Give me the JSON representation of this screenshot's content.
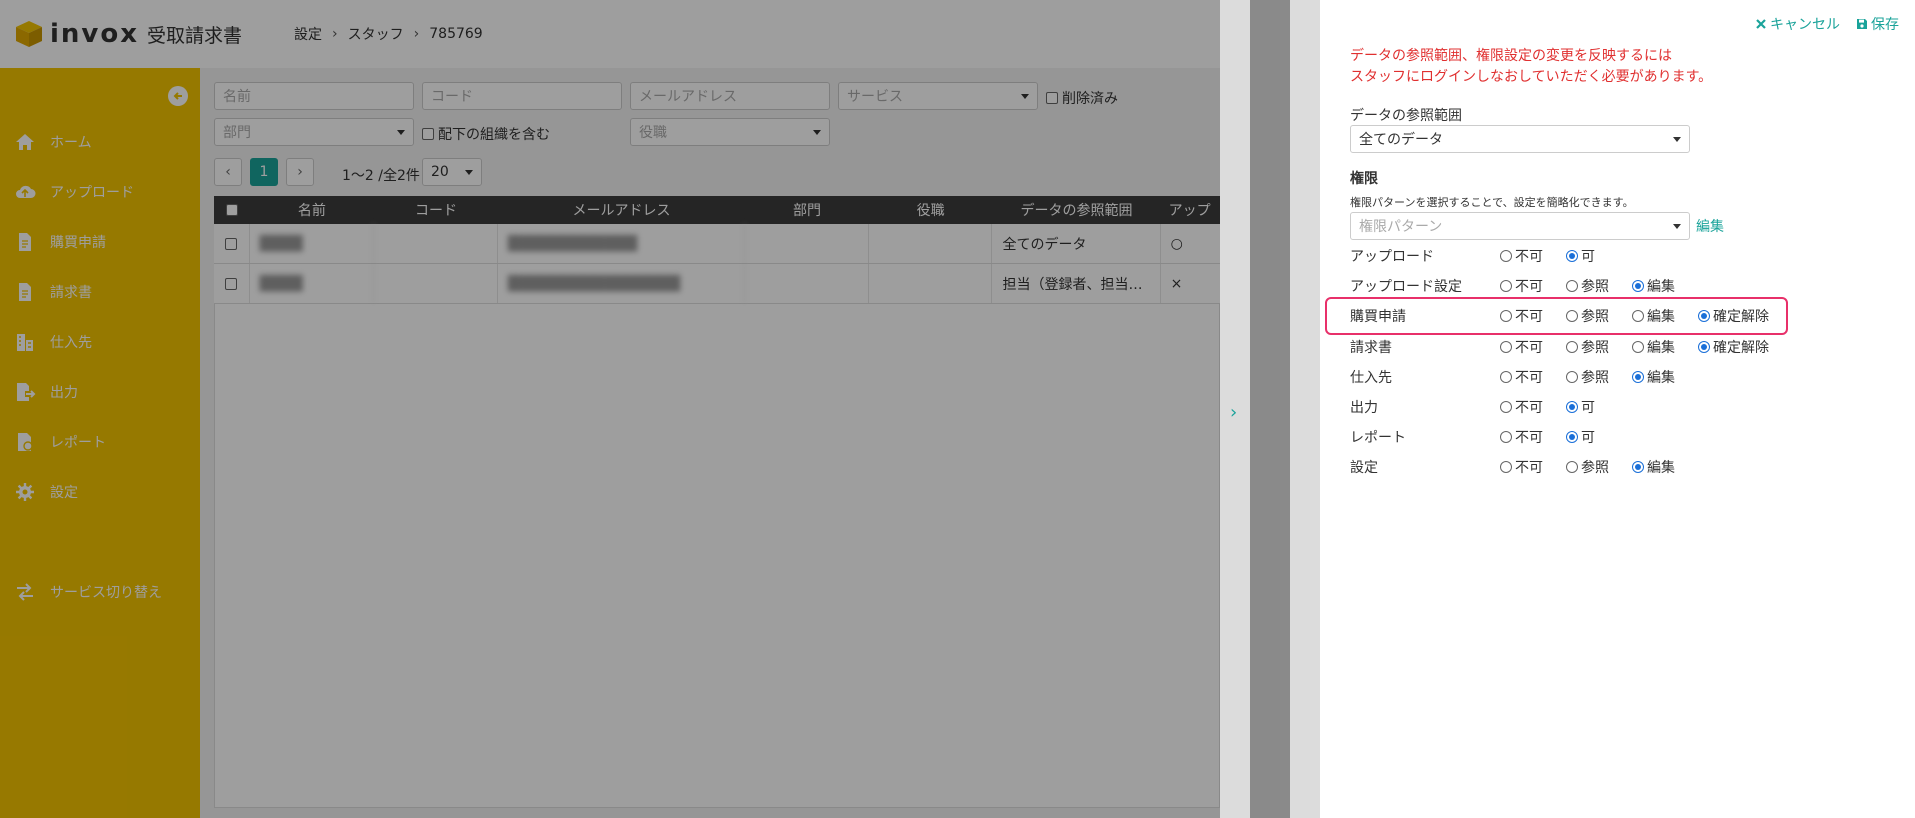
{
  "header": {
    "brand": "invox",
    "product": "受取請求書",
    "breadcrumb": [
      "設定",
      "スタッフ",
      "785769"
    ]
  },
  "sidebar": {
    "items": [
      {
        "label": "ホーム",
        "icon": "home-icon"
      },
      {
        "label": "アップロード",
        "icon": "cloud-upload-icon"
      },
      {
        "label": "購買申請",
        "icon": "document-icon"
      },
      {
        "label": "請求書",
        "icon": "document-icon"
      },
      {
        "label": "仕入先",
        "icon": "building-icon"
      },
      {
        "label": "出力",
        "icon": "export-icon"
      },
      {
        "label": "レポート",
        "icon": "report-icon"
      },
      {
        "label": "設定",
        "icon": "gear-icon"
      }
    ],
    "service_switch": {
      "label": "サービス切り替え",
      "icon": "switch-icon"
    }
  },
  "filters": {
    "name_placeholder": "名前",
    "code_placeholder": "コード",
    "email_placeholder": "メールアドレス",
    "service_placeholder": "サービス",
    "deleted_label": "削除済み",
    "department_placeholder": "部門",
    "include_sub_label": "配下の組織を含む",
    "role_placeholder": "役職"
  },
  "pager": {
    "current_page": "1",
    "summary": "1〜2 /全2件",
    "per_page": "20"
  },
  "table": {
    "columns": [
      "名前",
      "コード",
      "メールアドレス",
      "部門",
      "役職",
      "データの参照範囲",
      "アップ"
    ],
    "rows": [
      {
        "name": "████",
        "code": "",
        "email": "████████████",
        "department": "",
        "role": "",
        "scope": "全てのデータ",
        "upload": "○"
      },
      {
        "name": "████",
        "code": "",
        "email": "████████████████",
        "department": "",
        "role": "",
        "scope": "担当（登録者、担当…",
        "upload": "×"
      }
    ]
  },
  "panel": {
    "cancel_label": "キャンセル",
    "save_label": "保存",
    "notice_line1": "データの参照範囲、権限設定の変更を反映するには",
    "notice_line2": "スタッフにログインしなおしていただく必要があります。",
    "scope_label": "データの参照範囲",
    "scope_value": "全てのデータ",
    "perm_heading": "権限",
    "perm_hint": "権限パターンを選択することで、設定を簡略化できます。",
    "pattern_placeholder": "権限パターン",
    "pattern_edit": "編集",
    "permissions": [
      {
        "name": "アップロード",
        "options": [
          "不可",
          "可"
        ],
        "selected": "可"
      },
      {
        "name": "アップロード設定",
        "options": [
          "不可",
          "参照",
          "編集"
        ],
        "selected": "編集"
      },
      {
        "name": "購買申請",
        "options": [
          "不可",
          "参照",
          "編集",
          "確定解除"
        ],
        "selected": "確定解除"
      },
      {
        "name": "請求書",
        "options": [
          "不可",
          "参照",
          "編集",
          "確定解除"
        ],
        "selected": "確定解除"
      },
      {
        "name": "仕入先",
        "options": [
          "不可",
          "参照",
          "編集"
        ],
        "selected": "編集"
      },
      {
        "name": "出力",
        "options": [
          "不可",
          "可"
        ],
        "selected": "可"
      },
      {
        "name": "レポート",
        "options": [
          "不可",
          "可"
        ],
        "selected": "可"
      },
      {
        "name": "設定",
        "options": [
          "不可",
          "参照",
          "編集"
        ],
        "selected": "編集"
      }
    ]
  },
  "colors": {
    "sidebar": "#f3c400",
    "accent": "#1aa39a",
    "notice": "#e03030",
    "highlight": "#e8306a",
    "radio_selected": "#1a6fd8"
  }
}
